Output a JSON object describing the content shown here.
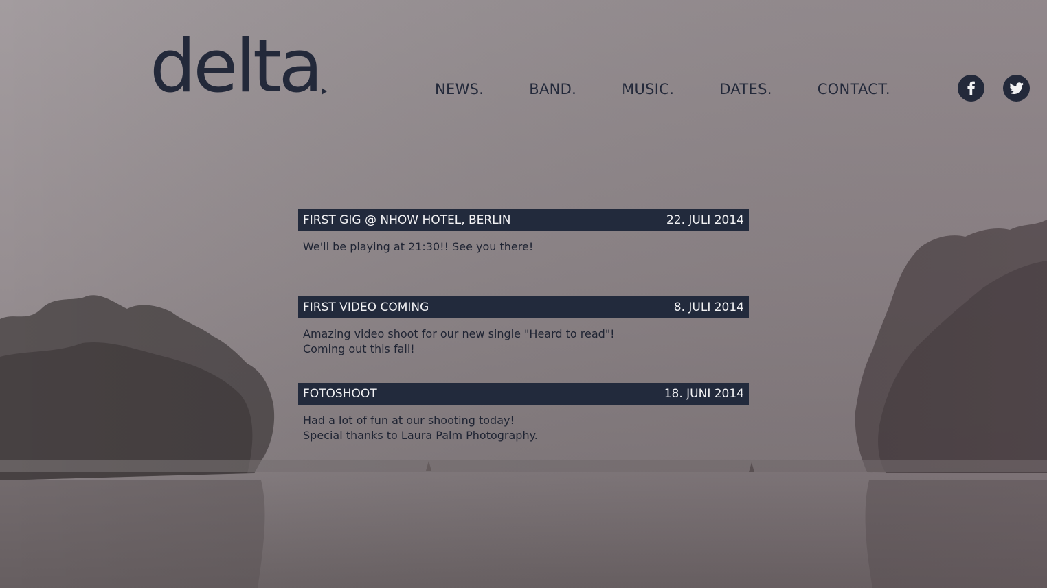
{
  "site": {
    "logo": "delta",
    "nav": [
      "NEWS.",
      "BAND.",
      "MUSIC.",
      "DATES.",
      "CONTACT."
    ],
    "social": [
      "facebook-icon",
      "twitter-icon"
    ]
  },
  "news": [
    {
      "title": "FIRST GIG @ NHOW HOTEL, BERLIN",
      "date": "22. JULI 2014",
      "lines": [
        "We'll be playing at 21:30!! See you there!"
      ]
    },
    {
      "title": "FIRST VIDEO COMING",
      "date": "8. JULI 2014",
      "lines": [
        "Amazing video shoot for our new single \"Heard to read\"!",
        "Coming out this fall!"
      ]
    },
    {
      "title": "FOTOSHOOT",
      "date": "18. JUNI 2014",
      "lines": [
        "Had a lot of fun at our shooting today!",
        "Special thanks to Laura Palm Photography."
      ]
    }
  ],
  "colors": {
    "brand": "#23293a",
    "headline_bar": "#222a3c"
  }
}
